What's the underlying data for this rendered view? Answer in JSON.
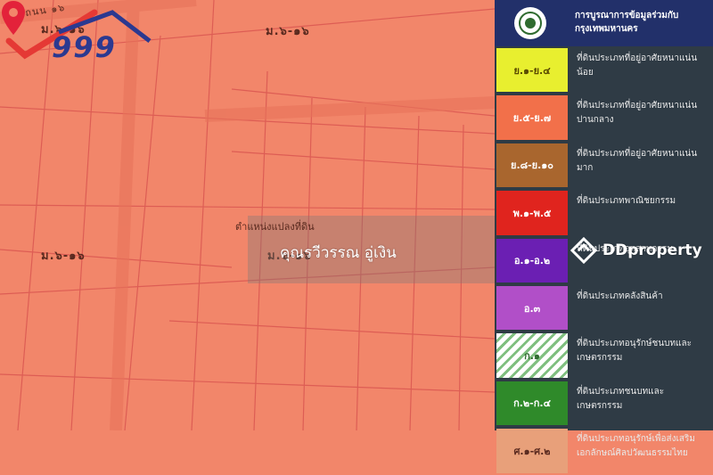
{
  "map": {
    "zone_labels": [
      "ม.๖-๑๖",
      "ม.๖-๑๖",
      "ม.๖-๑๖",
      "ม.๖-๑๖"
    ],
    "road_label": "ถนน ๑๖",
    "pin_label": "ตำแหน่งแปลงที่ดิน",
    "owner_name": "คุณรวีวรรณ อู่เงิน",
    "ddproperty": "DDproperty",
    "logo": "999"
  },
  "legend": {
    "header": "การบูรณาการข้อมูลร่วมกับ กรุงเทพมหานคร",
    "rows": [
      {
        "code": "ย.๑-ย.๔",
        "desc": "ที่ดินประเภทที่อยู่อาศัยหนาแน่นน้อย",
        "color": "#e8ef2f",
        "text_color": "#5a4a00"
      },
      {
        "code": "ย.๕-ย.๗",
        "desc": "ที่ดินประเภทที่อยู่อาศัยหนาแน่นปานกลาง",
        "color": "#f2704a",
        "text_color": "#ffffff"
      },
      {
        "code": "ย.๘-ย.๑๐",
        "desc": "ที่ดินประเภทที่อยู่อาศัยหนาแน่นมาก",
        "color": "#a9662e",
        "text_color": "#ffffff"
      },
      {
        "code": "พ.๑-พ.๕",
        "desc": "ที่ดินประเภทพาณิชยกรรม",
        "color": "#e0241e",
        "text_color": "#ffffff"
      },
      {
        "code": "อ.๑-อ.๒",
        "desc": "ที่ดินประเภทอุตสาหกรรม",
        "color": "#6b1fb3",
        "text_color": "#ffffff"
      },
      {
        "code": "อ.๓",
        "desc": "ที่ดินประเภทคลังสินค้า",
        "color": "#b14fc8",
        "text_color": "#ffffff"
      },
      {
        "code": "ก.๑",
        "desc": "ที่ดินประเภทอนุรักษ์ชนบทและเกษตรกรรม",
        "color": "#ffffff",
        "text_color": "#2f6b2f"
      },
      {
        "code": "ก.๒-ก.๔",
        "desc": "ที่ดินประเภทชนบทและเกษตรกรรม",
        "color": "#2f8a2a",
        "text_color": "#ffffff"
      },
      {
        "code": "ศ.๑-ศ.๒",
        "desc": "ที่ดินประเภทอนุรักษ์เพื่อส่งเสริมเอกลักษณ์ศิลปวัฒนธรรมไทย",
        "color": "#e8a07a",
        "text_color": "#5a2a1f"
      }
    ]
  }
}
